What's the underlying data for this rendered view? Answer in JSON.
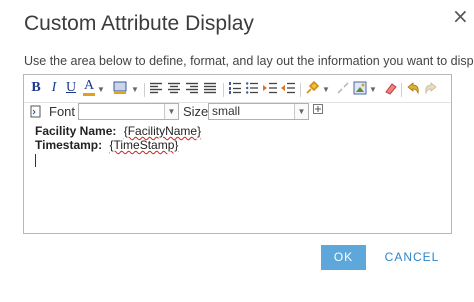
{
  "dialog": {
    "title": "Custom Attribute Display",
    "close_glyph": "×",
    "instruction": "Use the area below to define, format, and lay out the information you want to display."
  },
  "toolbar": {
    "bold": "B",
    "italic": "I",
    "underline": "U",
    "font_color": "A",
    "dropdown_caret": "▼",
    "icons": [
      "bold-icon",
      "italic-icon",
      "underline-icon",
      "font-color-icon",
      "highlight-color-icon",
      "align-left-icon",
      "align-center-icon",
      "align-right-icon",
      "justify-icon",
      "numbered-list-icon",
      "bullet-list-icon",
      "indent-icon",
      "outdent-icon",
      "insert-link-icon",
      "unlink-icon",
      "insert-image-icon",
      "remove-format-icon",
      "undo-icon",
      "redo-icon",
      "source-icon",
      "add-icon"
    ]
  },
  "font_row": {
    "font_label": "Font",
    "font_value": "",
    "size_label": "Size",
    "size_value": "small"
  },
  "content": {
    "line1_label": "Facility Name:",
    "line1_field": "{FacilityName}",
    "line2_label": "Timestamp:",
    "line2_field": "{TimeStamp}"
  },
  "buttons": {
    "ok": "OK",
    "cancel": "CANCEL"
  },
  "colors": {
    "accent": "#5ea7db",
    "link": "#2e86c8"
  }
}
